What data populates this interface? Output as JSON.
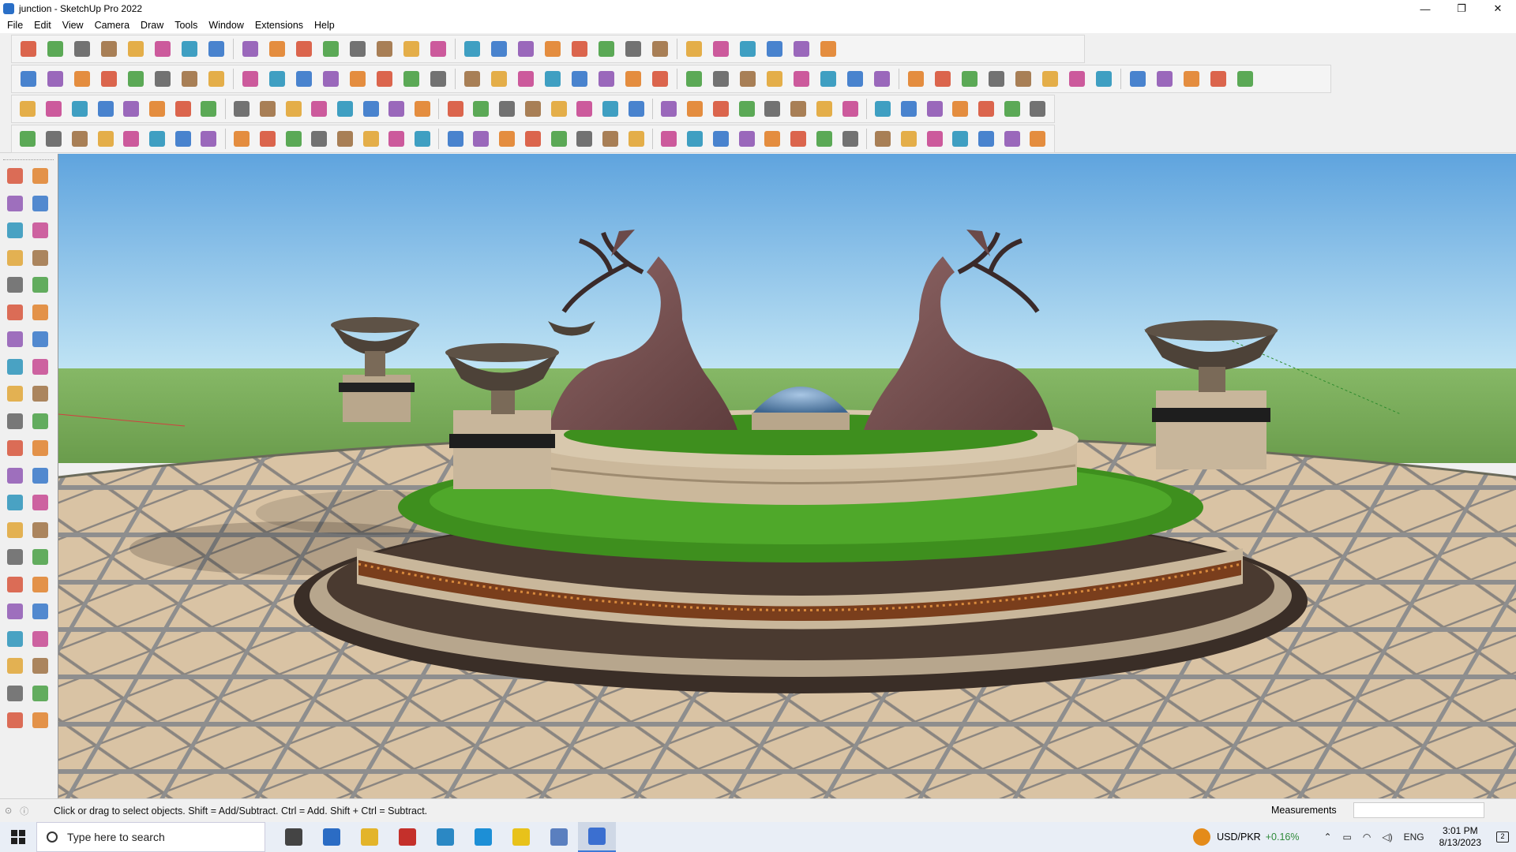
{
  "window": {
    "title": "junction - SketchUp Pro 2022",
    "controls": {
      "minimize": "—",
      "restore": "❐",
      "close": "✕"
    }
  },
  "menu": [
    "File",
    "Edit",
    "View",
    "Camera",
    "Draw",
    "Tools",
    "Window",
    "Extensions",
    "Help"
  ],
  "toolbar_rows": [
    {
      "name": "row-1",
      "icons": [
        "zoom-icon",
        "select-icon",
        "eraser-icon",
        "line-icon",
        "arc-icon",
        "rectangle-icon",
        "push-pull-icon",
        "follow-me-icon",
        "move-icon",
        "rotate-icon",
        "scale-icon",
        "tape-measure-icon",
        "text-icon",
        "paint-bucket-icon",
        "orbit-icon",
        "pan-icon",
        "zoom-window-icon",
        "zoom-extents-icon",
        "component-icon",
        "layers-icon",
        "section-icon",
        "user-icon",
        "warehouse-icon",
        "extension-icon",
        "style-icon",
        "sandbox-icon",
        "intersect-icon",
        "flip-icon",
        "undo-icon",
        "redo-icon"
      ]
    },
    {
      "name": "row-2",
      "icons": [
        "box-icon",
        "iso-view-icon",
        "front-view-icon",
        "push-red-icon",
        "push-dark-icon",
        "push-blue-icon",
        "push-orange-icon",
        "push-green-icon",
        "push-amber-icon",
        "push-orange2-icon",
        "push-pink-icon",
        "curve-icon",
        "solid-union-icon",
        "solid-subtract-icon",
        "solid-trim-icon",
        "plane-green-icon",
        "plane-arrows-icon",
        "house-side-icon",
        "wall-icon",
        "house-icon",
        "roof-icon",
        "house-outline-icon",
        "garage-icon",
        "formula-icon",
        "leaf-icon",
        "pencil-red-icon",
        "rect-outline-icon",
        "circle-outline-icon",
        "hexagon-icon",
        "ellipse-icon",
        "parallelogram-icon",
        "arc-outline-icon",
        "gear-outline-icon",
        "tag-icon",
        "shape-blue-icon",
        "shape-gray-icon",
        "resize-icon",
        "eraser-pink-icon",
        "brick-icon",
        "grid-red-icon",
        "shape-red-icon",
        "shape-dark-icon",
        "glove-icon",
        "block-icon",
        "panel-icon"
      ]
    },
    {
      "name": "row-3",
      "icons": [
        "plane-blue-icon",
        "plane-blue2-icon",
        "plane-yellow-icon",
        "plane-lime-icon",
        "plane-red-icon",
        "plane-outline-icon",
        "loop-icon",
        "square-red-icon",
        "lines-icon",
        "flag-icon",
        "wood-icon",
        "pipe-icon",
        "corner-icon",
        "dots-curve-icon",
        "cross-red-icon",
        "cross-green-icon",
        "cross-blue-icon",
        "cone-icon",
        "tree-icon",
        "triangle-icon",
        "spiral-icon",
        "knot-icon",
        "spiral2-icon",
        "arrows-icon",
        "cup-icon",
        "hook-red-icon",
        "grid-green-icon",
        "nodes-icon",
        "nodes-red-icon",
        "nodes-brown-icon",
        "cube-red-icon",
        "stars-icon",
        "bridge-icon",
        "grid-orange-icon",
        "grid-orange2-icon",
        "grid-yellow-icon",
        "mini-cross-icon",
        "dotted-curve-icon",
        "layout-icon"
      ]
    },
    {
      "name": "row-4",
      "icons": [
        "path-icon",
        "curve-red-icon",
        "car-icon",
        "scissors-icon",
        "gear-icon",
        "ribbon-icon",
        "spring-icon",
        "coil-icon",
        "mesh-icon",
        "curl-icon",
        "corner2-icon",
        "corner3-icon",
        "line-red-icon",
        "curve-red2-icon",
        "facade-icon",
        "slope-icon",
        "comb-icon",
        "grid-gray-icon",
        "hand-icon",
        "leaf2-icon",
        "fan-icon",
        "stairs-icon",
        "slash-icon",
        "fork-icon",
        "fork2-icon",
        "fork3-icon",
        "block-gray-icon",
        "slats-icon",
        "cube-gray-icon",
        "ramp-icon",
        "bars-icon",
        "grid-dark-icon",
        "stairs2-icon",
        "pillars-icon",
        "spiral-dark-icon",
        "turbine-icon",
        "slats2-icon",
        "fan2-icon",
        "polygon-icon"
      ]
    }
  ],
  "left_toolbar_icons": [
    "select-icon",
    "make-component-icon",
    "paint-bucket-icon",
    "eraser-icon",
    "tape-measure-icon",
    "pencil-icon",
    "line-icon",
    "freehand-icon",
    "rectangle-icon",
    "rotated-rectangle-icon",
    "circle-icon",
    "polygon-icon",
    "arc-icon",
    "two-point-arc-icon",
    "three-point-arc-icon",
    "pie-icon",
    "move-icon",
    "push-pull-icon",
    "rotate-icon",
    "follow-me-icon",
    "scale-icon",
    "offset-icon",
    "tape-icon",
    "dimension-icon",
    "protractor-icon",
    "text-icon",
    "axes-icon",
    "3d-text-icon",
    "orbit-icon",
    "pan-icon",
    "zoom-icon",
    "zoom-window-icon",
    "zoom-extents-icon",
    "previous-icon",
    "position-camera-icon",
    "look-around-icon",
    "walk-icon",
    "section-plane-icon",
    "section-display-icon",
    "section-fill-icon",
    "layers-icon",
    "layers2-icon"
  ],
  "status": {
    "text": "Click or drag to select objects. Shift = Add/Subtract. Ctrl = Add. Shift + Ctrl = Subtract.",
    "measurements_label": "Measurements",
    "measurements_value": ""
  },
  "taskbar": {
    "search_placeholder": "Type here to search",
    "apps": [
      "task-view-icon",
      "calculator-icon",
      "file-explorer-icon",
      "acrobat-icon",
      "store-icon",
      "edge-icon",
      "sticky-notes-icon",
      "layout-icon",
      "sketchup-icon"
    ],
    "ticker": "USD/PKR",
    "ticker_change": "+0.16%",
    "language": "ENG",
    "time": "3:01 PM",
    "date": "8/13/2023",
    "notifications": "2"
  },
  "colors": {
    "sky_top": "#5fa4de",
    "sky_bottom": "#b8e0f3",
    "ground": "#7cae5c",
    "grass": "#3e8f1e",
    "stone": "#c8b59a",
    "deer": "#7a5252"
  }
}
